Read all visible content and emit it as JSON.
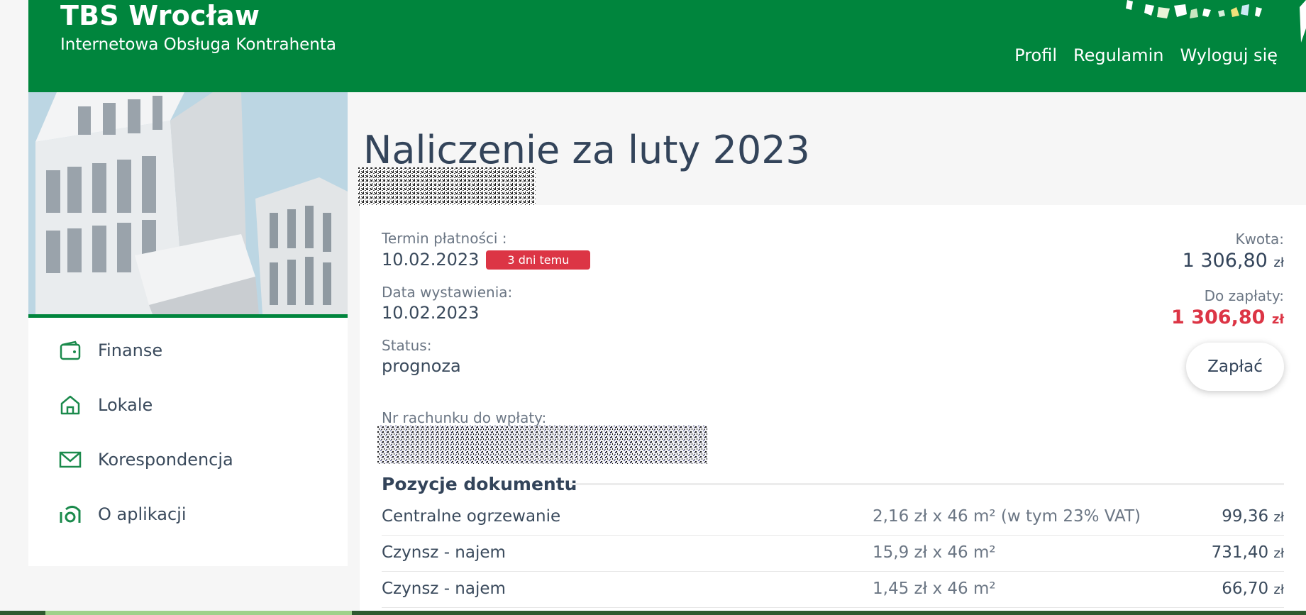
{
  "header": {
    "title": "TBS Wrocław",
    "subtitle": "Internetowa Obsługa Kontrahenta",
    "nav": [
      "Profil",
      "Regulamin",
      "Wyloguj się"
    ],
    "bg_color": "#00853d"
  },
  "sidebar": {
    "items": [
      {
        "label": "Finanse",
        "icon": "wallet-icon"
      },
      {
        "label": "Lokale",
        "icon": "home-icon"
      },
      {
        "label": "Korespondencja",
        "icon": "envelope-icon"
      },
      {
        "label": "O aplikacji",
        "icon": "info-icon"
      }
    ]
  },
  "main": {
    "title": "Naliczenie za luty 2023",
    "due_label": "Termin płatności :",
    "due_date": "10.02.2023",
    "due_badge": "3 dni temu",
    "issue_label": "Data wystawienia:",
    "issue_date": "10.02.2023",
    "status_label": "Status:",
    "status_value": "prognoza",
    "amount_label": "Kwota:",
    "amount_value": "1 306,80",
    "to_pay_label": "Do zapłaty:",
    "to_pay_value": "1 306,80",
    "currency": "zł",
    "pay_button": "Zapłać",
    "account_label": "Nr rachunku do wpłaty:",
    "positions_title": "Pozycje dokumentu",
    "positions": [
      {
        "name": "Centralne ogrzewanie",
        "calc": "2,16 zł x 46 m² (w tym 23% VAT)",
        "amount": "99,36"
      },
      {
        "name": "Czynsz - najem",
        "calc": "15,9 zł x 46 m²",
        "amount": "731,40"
      },
      {
        "name": "Czynsz - najem",
        "calc": "1,45 zł x 46 m²",
        "amount": "66,70"
      }
    ],
    "accent_red": "#dc3545",
    "text_dark": "#33445a"
  }
}
